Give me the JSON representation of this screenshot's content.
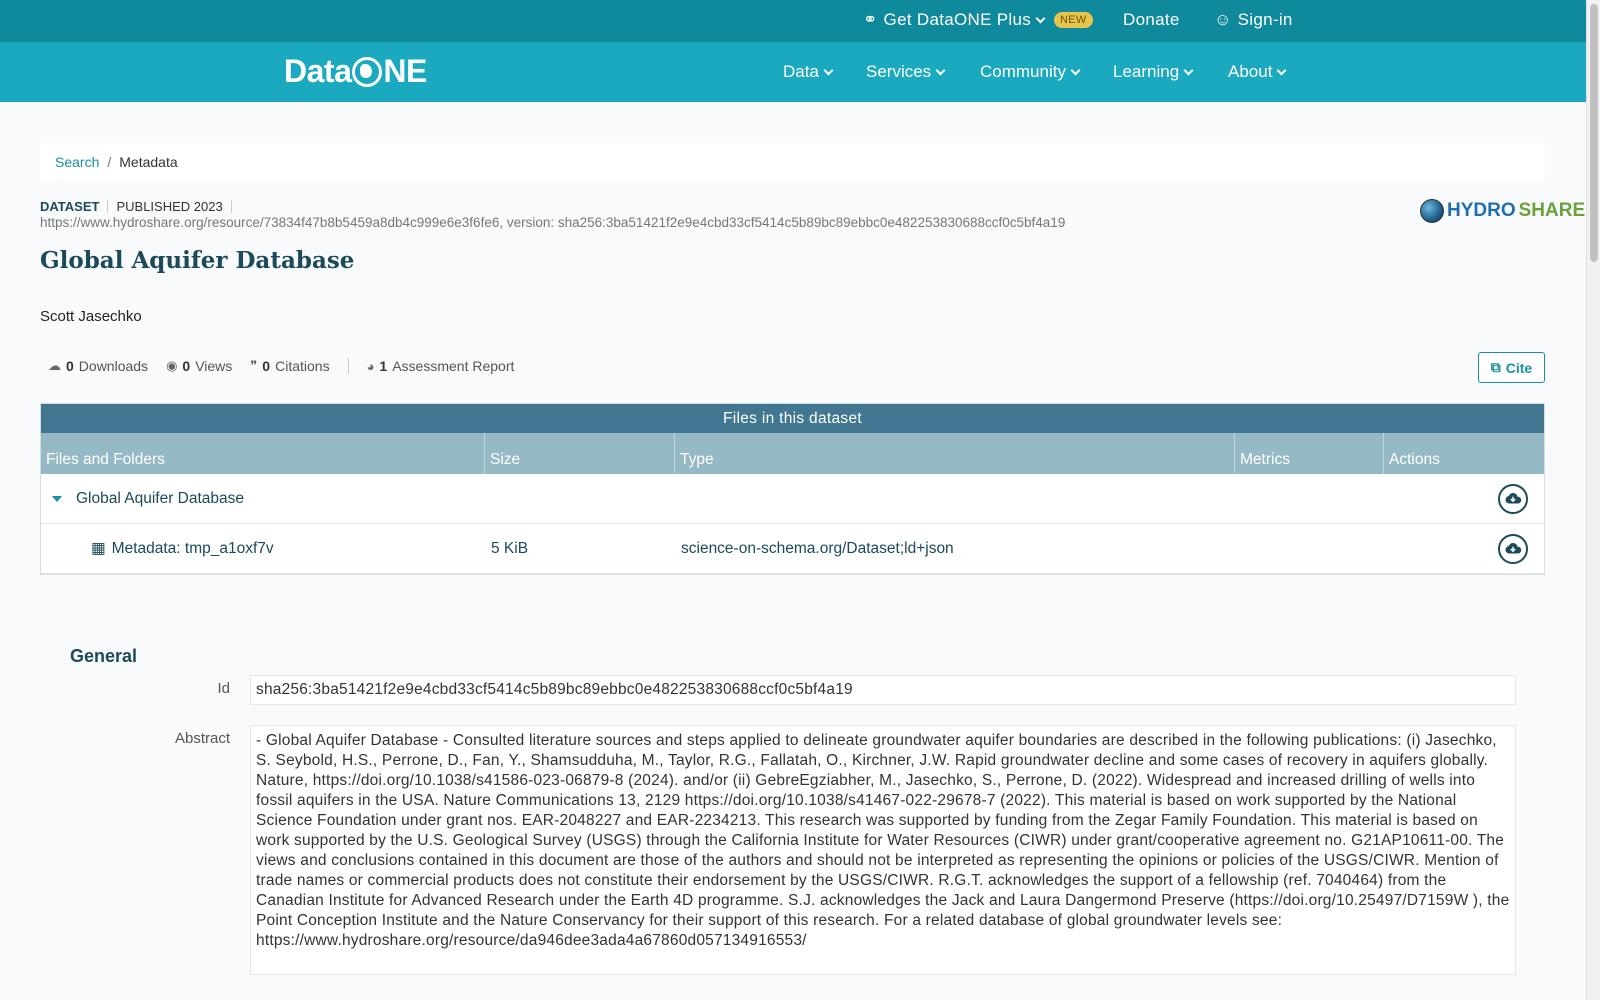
{
  "topbar": {
    "plus_label": "Get DataONE Plus",
    "new_badge": "NEW",
    "donate_label": "Donate",
    "signin_label": "Sign-in"
  },
  "navbar": {
    "logo_left": "Data",
    "logo_right": "NE",
    "items": [
      "Data",
      "Services",
      "Community",
      "Learning",
      "About"
    ]
  },
  "breadcrumb": {
    "search": "Search",
    "separator": "/",
    "current": "Metadata"
  },
  "dataset": {
    "type": "DATASET",
    "published": "PUBLISHED 2023",
    "pid": "https://www.hydroshare.org/resource/73834f47b8b5459a8db4c999e6e3f6fe6, version: sha256:3ba51421f2e9e4cbd33cf5414c5b89bc89ebbc0e482253830688ccf0c5bf4a19",
    "title": "Global Aquifer Database",
    "author": "Scott Jasechko",
    "repository_left": "HYDRO",
    "repository_right": "SHARE"
  },
  "stats": {
    "downloads_count": "0",
    "downloads_label": "Downloads",
    "views_count": "0",
    "views_label": "Views",
    "citations_count": "0",
    "citations_label": "Citations",
    "assessment_count": "1",
    "assessment_label": "Assessment Report"
  },
  "cite_label": "Cite",
  "files": {
    "caption": "Files in this dataset",
    "headers": [
      "Files and Folders",
      "Size",
      "Type",
      "Metrics",
      "Actions"
    ],
    "folder_name": "Global Aquifer Database",
    "rows": [
      {
        "name": "Metadata: tmp_a1oxf7v",
        "size": "5 KiB",
        "type": "science-on-schema.org/Dataset;ld+json"
      }
    ]
  },
  "general": {
    "heading": "General",
    "id_label": "Id",
    "id_value": "sha256:3ba51421f2e9e4cbd33cf5414c5b89bc89ebbc0e482253830688ccf0c5bf4a19",
    "abstract_label": "Abstract",
    "abstract_value": "- Global Aquifer Database - Consulted literature sources and steps applied to delineate groundwater aquifer boundaries are described in the following publications: (i) Jasechko, S. Seybold, H.S., Perrone, D., Fan, Y., Shamsudduha, M., Taylor, R.G., Fallatah, O., Kirchner, J.W. Rapid groundwater decline and some cases of recovery in aquifers globally. Nature, https://doi.org/10.1038/s41586-023-06879-8 (2024). and/or (ii) GebreEgziabher, M., Jasechko, S., Perrone, D. (2022). Widespread and increased drilling of wells into fossil aquifers in the USA. Nature Communications 13, 2129 https://doi.org/10.1038/s41467-022-29678-7 (2022). This material is based on work supported by the National Science Foundation under grant nos. EAR-2048227 and EAR-2234213. This research was supported by funding from the Zegar Family Foundation. This material is based on work supported by the U.S. Geological Survey (USGS) through the California Institute for Water Resources (CIWR) under grant/cooperative agreement no. G21AP10611-00. The views and conclusions contained in this document are those of the authors and should not be interpreted as representing the opinions or policies of the USGS/CIWR. Mention of trade names or commercial products does not constitute their endorsement by the USGS/CIWR. R.G.T. acknowledges the support of a fellowship (ref. 7040464) from the Canadian Institute for Advanced Research under the Earth 4D programme. S.J. acknowledges the Jack and Laura Dangermond Preserve (https://doi.org/10.25497/D7159W ), the Point Conception Institute and the Nature Conservancy for their support of this research. For a related database of global groundwater levels see: https://www.hydroshare.org/resource/da946dee3ada4a67860d057134916553/"
  }
}
